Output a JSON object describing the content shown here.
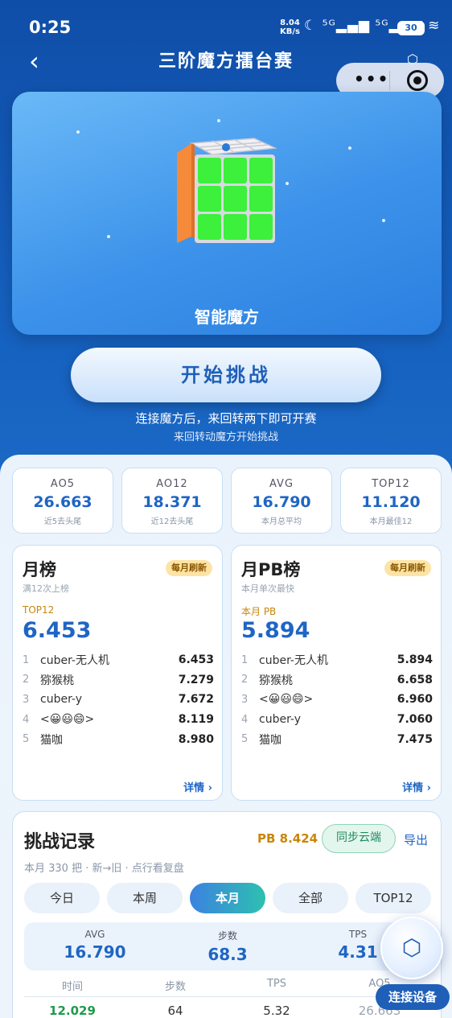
{
  "status_bar": {
    "time": "0:25",
    "speed_value": "8.04",
    "speed_unit": "KB/s",
    "icons": "☾ ⁵ᴳ▂▄▆ ⁵ᴳ▂▄▆ ≋",
    "battery": "30"
  },
  "nav": {
    "back_icon": "chevron-left-icon",
    "back_glyph": "‹",
    "title": "三阶魔方擂台赛",
    "capsule_dots": "•••"
  },
  "hero": {
    "label": "智能魔方"
  },
  "start": {
    "button_label": "开始挑战",
    "hint_main": "连接魔方后，来回转两下即可开赛",
    "hint_sub": "来回转动魔方开始挑战"
  },
  "stats": [
    {
      "name": "AO5",
      "value": "26.663",
      "sub": "近5去头尾"
    },
    {
      "name": "AO12",
      "value": "18.371",
      "sub": "近12去头尾"
    },
    {
      "name": "AVG",
      "value": "16.790",
      "sub": "本月总平均"
    },
    {
      "name": "TOP12",
      "value": "11.120",
      "sub": "本月最佳12"
    }
  ],
  "monthly": {
    "title": "月榜",
    "badge": "每月刷新",
    "sub": "满12次上榜",
    "top_label": "TOP12",
    "top_value": "6.453",
    "more": "详情 ›",
    "rows": [
      {
        "idx": "1",
        "name": "cuber-无人机",
        "value": "6.453"
      },
      {
        "idx": "2",
        "name": "猕猴桃",
        "value": "7.279"
      },
      {
        "idx": "3",
        "name": "cuber-y",
        "value": "7.672"
      },
      {
        "idx": "4",
        "name": "<😀😃😄>",
        "value": "8.119"
      },
      {
        "idx": "5",
        "name": "猫咖",
        "value": "8.980"
      }
    ]
  },
  "monthly_pb": {
    "title": "月PB榜",
    "badge": "每月刷新",
    "sub": "本月单次最快",
    "top_label": "本月 PB",
    "top_value": "5.894",
    "more": "详情 ›",
    "rows": [
      {
        "idx": "1",
        "name": "cuber-无人机",
        "value": "5.894"
      },
      {
        "idx": "2",
        "name": "猕猴桃",
        "value": "6.658"
      },
      {
        "idx": "3",
        "name": "<😀😃😄>",
        "value": "6.960"
      },
      {
        "idx": "4",
        "name": "cuber-y",
        "value": "7.060"
      },
      {
        "idx": "5",
        "name": "猫咖",
        "value": "7.475"
      }
    ]
  },
  "records": {
    "title": "挑战记录",
    "pb": "PB 8.424",
    "sync": "同步云端",
    "export": "导出",
    "sub": "本月 330 把 · 新→旧 · 点行看复盘",
    "tabs": [
      "今日",
      "本周",
      "本月",
      "全部",
      "TOP12"
    ],
    "active_tab": "本月",
    "summary": [
      {
        "name": "AVG",
        "value": "16.790"
      },
      {
        "name": "步数",
        "value": "68.3"
      },
      {
        "name": "TPS",
        "value": "4.31"
      }
    ],
    "columns": [
      "时间",
      "步数",
      "TPS",
      "AO5"
    ],
    "rows": [
      {
        "time": "12.029",
        "moves": "64",
        "tps": "5.32",
        "ao5": "26.663"
      }
    ]
  },
  "fab": {
    "icon": "hexagon-icon",
    "glyph": "⬡",
    "label": "连接设备"
  },
  "colors": {
    "accent": "#1f65c5",
    "gold": "#c8860a",
    "green": "#1f9a4c"
  }
}
